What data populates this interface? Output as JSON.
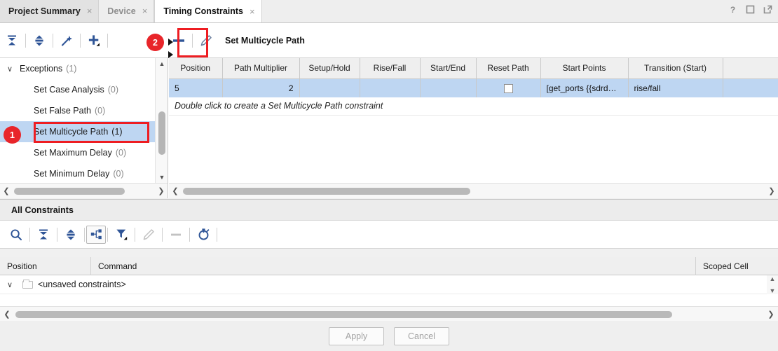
{
  "tabs": [
    {
      "label": "Project Summary",
      "state": "inactive-dark",
      "close": "×"
    },
    {
      "label": "Device",
      "state": "inactive-light",
      "close": "×"
    },
    {
      "label": "Timing Constraints",
      "state": "active",
      "close": "×"
    }
  ],
  "window_icons": [
    {
      "name": "help-icon",
      "glyph": "?"
    },
    {
      "name": "maximize-icon",
      "glyph": "□"
    },
    {
      "name": "float-window-icon",
      "glyph": "↗"
    }
  ],
  "toolbar": {
    "title": "Set Multicycle Path",
    "buttons": [
      {
        "name": "collapse-all-icon",
        "tip": "Collapse All"
      },
      {
        "name": "expand-all-icon",
        "tip": "Expand All"
      },
      {
        "name": "magic-wand-icon",
        "tip": "Create Constraint"
      },
      {
        "name": "add-dropdown-icon",
        "tip": "Add"
      },
      {
        "name": "add-constraint-icon",
        "tip": "Add Row"
      },
      {
        "name": "remove-constraint-icon",
        "tip": "Remove Row"
      },
      {
        "name": "edit-constraint-icon",
        "tip": "Edit"
      }
    ]
  },
  "tree": {
    "root": {
      "label": "Exceptions",
      "count": "(1)",
      "twisty": "∨"
    },
    "items": [
      {
        "label": "Set Case Analysis",
        "count": "(0)",
        "selected": false
      },
      {
        "label": "Set False Path",
        "count": "(0)",
        "selected": false
      },
      {
        "label": "Set Multicycle Path",
        "count": "(1)",
        "selected": true
      },
      {
        "label": "Set Maximum Delay",
        "count": "(0)",
        "selected": false
      },
      {
        "label": "Set Minimum Delay",
        "count": "(0)",
        "selected": false
      }
    ]
  },
  "table": {
    "columns": [
      "Position",
      "Path Multiplier",
      "Setup/Hold",
      "Rise/Fall",
      "Start/End",
      "Reset Path",
      "Start Points",
      "Transition (Start)"
    ],
    "rows": [
      {
        "position": "5",
        "path_multiplier": "2",
        "setup_hold": "",
        "rise_fall": "",
        "start_end": "",
        "reset_path_checked": false,
        "start_points": "[get_ports {{sdrd…",
        "transition_start": "rise/fall",
        "selected": true
      }
    ],
    "hint": "Double click to create a Set Multicycle Path constraint"
  },
  "all_constraints": {
    "title": "All Constraints",
    "buttons": [
      {
        "name": "search-icon"
      },
      {
        "name": "collapse-all-icon"
      },
      {
        "name": "expand-all-icon"
      },
      {
        "name": "hierarchy-icon",
        "active": true
      },
      {
        "name": "filter-icon"
      },
      {
        "name": "edit-icon",
        "disabled": true
      },
      {
        "name": "remove-icon",
        "disabled": true
      },
      {
        "name": "reset-timer-icon"
      }
    ],
    "columns": [
      "Position",
      "Command",
      "Scoped Cell"
    ],
    "rows": [
      {
        "twisty": "∨",
        "icon": "folder-icon",
        "label": "<unsaved constraints>"
      }
    ]
  },
  "footer": {
    "apply_label": "Apply",
    "cancel_label": "Cancel"
  },
  "annotations": [
    {
      "name": "callout-badge-1",
      "number": "1"
    },
    {
      "name": "callout-badge-2",
      "number": "2"
    }
  ],
  "colors": {
    "accent": "#2f5597",
    "selection": "#bed6f2",
    "annotation_red": "#e8252a"
  }
}
